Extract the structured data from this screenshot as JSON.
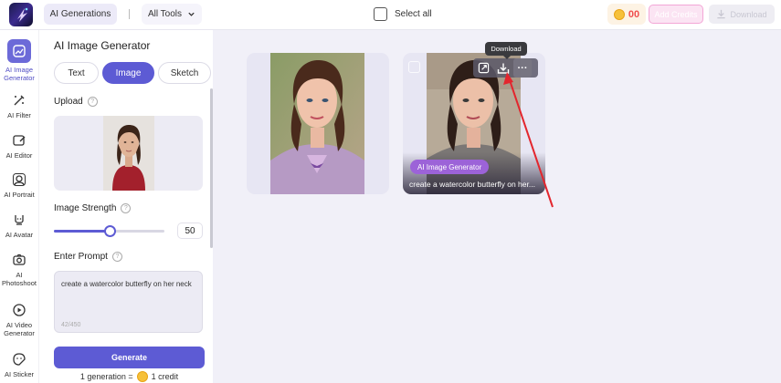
{
  "header": {
    "tab_label": "AI Generations",
    "tools_label": "All Tools",
    "select_all_label": "Select all",
    "credits_value": "00",
    "add_credits_label": "Add Credits",
    "download_label": "Download"
  },
  "sidebar": {
    "items": [
      {
        "label": "AI Image Generator",
        "icon": "image-generator-icon",
        "active": true
      },
      {
        "label": "AI Filter",
        "icon": "filter-icon"
      },
      {
        "label": "AI Editor",
        "icon": "editor-icon"
      },
      {
        "label": "AI Portrait",
        "icon": "portrait-icon"
      },
      {
        "label": "AI Avatar",
        "icon": "avatar-icon"
      },
      {
        "label": "AI Photoshoot",
        "icon": "camera-icon"
      },
      {
        "label": "AI Video Generator",
        "icon": "video-icon"
      },
      {
        "label": "AI Sticker",
        "icon": "sticker-icon"
      }
    ]
  },
  "panel": {
    "title": "AI Image Generator",
    "tabs": [
      {
        "label": "Text"
      },
      {
        "label": "Image",
        "selected": true
      },
      {
        "label": "Sketch"
      }
    ],
    "upload_label": "Upload",
    "strength_label": "Image Strength",
    "strength_value": "50",
    "strength_fraction": 0.5,
    "prompt_label": "Enter Prompt",
    "prompt_text": "create a watercolor butterfly on her neck",
    "prompt_count": "42/450",
    "generate_label": "Generate",
    "cost_left": "1 generation =",
    "cost_right": "1 credit",
    "help_glyph": "?"
  },
  "results": {
    "card2_badge": "AI Image Generator",
    "card2_caption": "create a watercolor butterfly on her...",
    "tooltip": "Download",
    "more_glyph": "···"
  },
  "colors": {
    "accent": "#5d5bd4",
    "badge": "#9c63d8",
    "annotation_arrow": "#e3262e"
  }
}
